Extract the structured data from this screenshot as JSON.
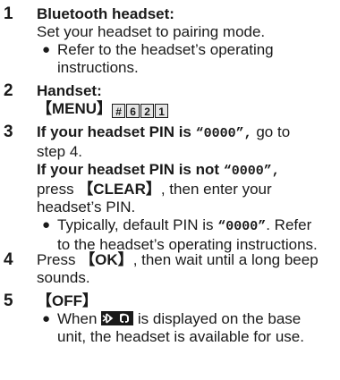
{
  "steps": [
    {
      "number": "1",
      "title": "Bluetooth headset:",
      "text": "Set your headset to pairing mode.",
      "bullet_line1": "Refer to the headset’s operating",
      "bullet_line2": "instructions."
    },
    {
      "number": "2",
      "title": "Handset:",
      "menu_key": "【MENU】",
      "keys": [
        "#",
        "6",
        "2",
        "1"
      ]
    },
    {
      "number": "3",
      "line1_a": "If your headset PIN is ",
      "line1_pin": "“0000”,",
      "line1_b": " go to",
      "line2": "step 4.",
      "line3_a": "If your headset PIN is not ",
      "line3_pin": "“0000”,",
      "line4_a": "press ",
      "line4_key": "【CLEAR】",
      "line4_b": ", then enter your",
      "line5": "headset’s PIN.",
      "bullet_line1_a": "Typically, default PIN is ",
      "bullet_line1_pin": "“0000”",
      "bullet_line1_b": ". Refer",
      "bullet_line2": "to the headset’s operating instructions."
    },
    {
      "number": "4",
      "line1_a": "Press ",
      "line1_key": "【OK】",
      "line1_b": ", then wait until a long beep",
      "line2": "sounds."
    },
    {
      "number": "5",
      "key": "【OFF】",
      "bullet_line1_a": "When ",
      "bullet_line1_icon": "bluetooth-headset-icon",
      "bullet_line1_b": " is displayed on the base",
      "bullet_line2": "unit, the headset is available for use."
    }
  ],
  "bullet_char": "●"
}
